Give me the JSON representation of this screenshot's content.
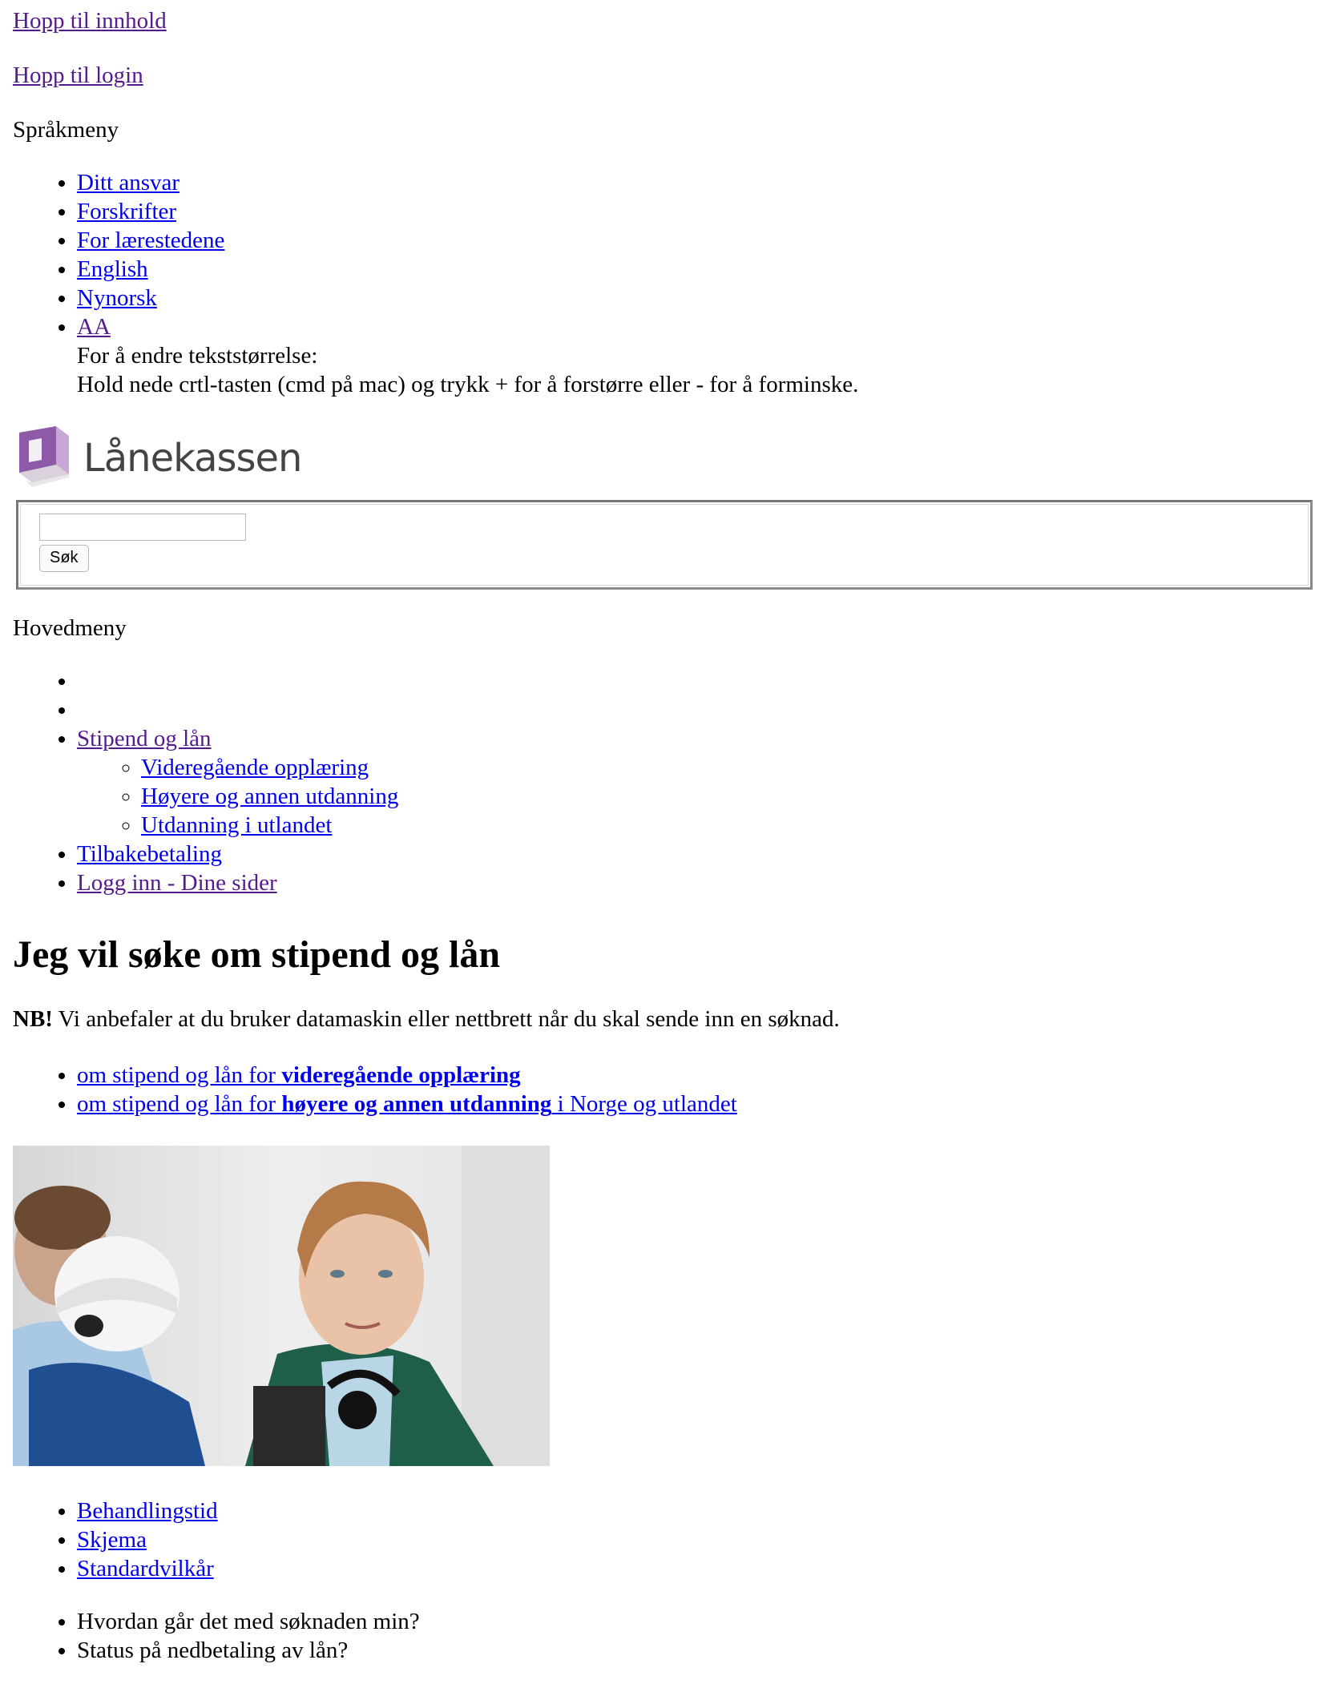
{
  "skip_links": {
    "content": "Hopp til innhold",
    "login": "Hopp til login"
  },
  "language_menu": {
    "label": "Språkmeny",
    "items": [
      "Ditt ansvar",
      "Forskrifter",
      "For lærestedene",
      "English",
      "Nynorsk",
      "AA"
    ],
    "textsize_title": "For å endre tekststørrelse:",
    "textsize_body": "Hold nede crtl-tasten (cmd på mac) og trykk + for å forstørre eller - for å forminske."
  },
  "logo": {
    "text": "Lånekassen",
    "colors": {
      "purple": "#8e5aa8",
      "light_purple": "#c9a6d8",
      "text": "#444444"
    }
  },
  "search": {
    "value": "",
    "button_label": "Søk"
  },
  "main_menu": {
    "label": "Hovedmeny",
    "items": [
      {
        "label": ""
      },
      {
        "label": ""
      },
      {
        "label": "Stipend og lån",
        "children": [
          "Videregående opplæring",
          "Høyere og annen utdanning",
          "Utdanning i utlandet"
        ]
      },
      {
        "label": "Tilbakebetaling"
      },
      {
        "label": "Logg inn - Dine sider"
      }
    ]
  },
  "main": {
    "heading": "Jeg vil søke om stipend og lån",
    "nb_label": "NB!",
    "nb_text": " Vi anbefaler at du bruker datamaskin eller nettbrett når du skal sende inn en søknad.",
    "apply_links": [
      {
        "prefix": "om stipend og lån for ",
        "bold": "videregående opplæring",
        "suffix": ""
      },
      {
        "prefix": "om stipend og lån for ",
        "bold": "høyere og annen utdanning",
        "suffix": " i Norge og utlandet"
      }
    ],
    "photo_alt": "students",
    "info_links": [
      "Behandlingstid",
      "Skjema",
      "Standardvilkår"
    ],
    "status_items": [
      "Hvordan går det med søknaden min?",
      "Status på nedbetaling av lån?"
    ]
  }
}
